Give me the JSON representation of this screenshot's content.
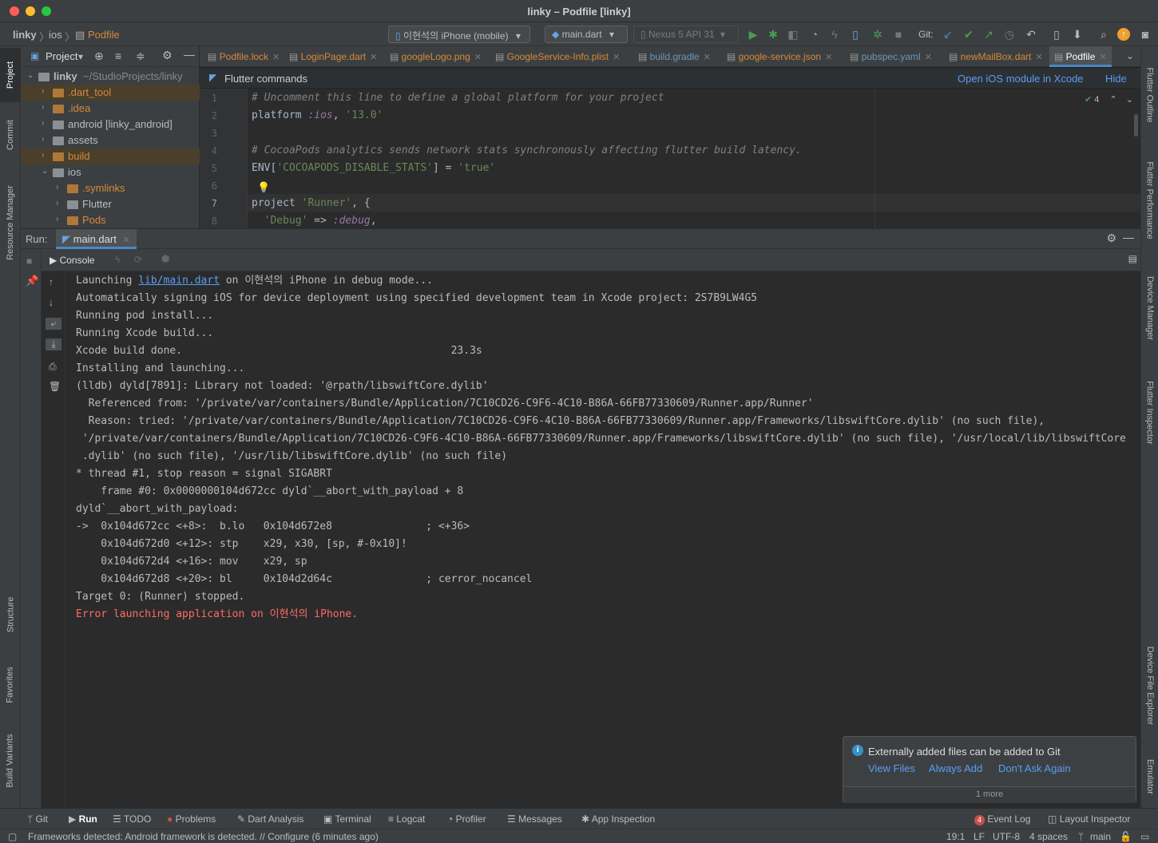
{
  "window": {
    "title": "linky – Podfile [linky]"
  },
  "nav": {
    "crumbs": [
      "linky",
      "ios",
      "Podfile"
    ],
    "device_combo": "이현석의 iPhone (mobile)",
    "run_config": "main.dart",
    "emulator_combo": "Nexus 5 API 31",
    "git_label": "Git:"
  },
  "project_panel": {
    "title": "Project",
    "items": [
      {
        "name": "linky",
        "suffix": "~/StudioProjects/linky",
        "level": 0,
        "expanded": true,
        "color": "#bbbbbb"
      },
      {
        "name": ".dart_tool",
        "level": 1,
        "expanded": false,
        "color": "#d48a3c"
      },
      {
        "name": ".idea",
        "level": 1,
        "expanded": false,
        "color": "#d48a3c"
      },
      {
        "name": "android [linky_android]",
        "level": 1,
        "expanded": false,
        "color": "#bbbbbb"
      },
      {
        "name": "assets",
        "level": 1,
        "expanded": false,
        "color": "#bbbbbb"
      },
      {
        "name": "build",
        "level": 1,
        "expanded": false,
        "color": "#d48a3c"
      },
      {
        "name": "ios",
        "level": 1,
        "expanded": true,
        "color": "#bbbbbb"
      },
      {
        "name": ".symlinks",
        "level": 2,
        "expanded": false,
        "color": "#d48a3c"
      },
      {
        "name": "Flutter",
        "level": 2,
        "expanded": false,
        "color": "#bbbbbb"
      },
      {
        "name": "Pods",
        "level": 2,
        "expanded": false,
        "color": "#d48a3c"
      }
    ]
  },
  "editor_tabs": [
    {
      "label": "Podfile.lock",
      "color": "#d48a3c"
    },
    {
      "label": "LoginPage.dart",
      "color": "#d48a3c"
    },
    {
      "label": "googleLogo.png",
      "color": "#d48a3c"
    },
    {
      "label": "GoogleService-Info.plist",
      "color": "#d48a3c"
    },
    {
      "label": "build.gradle",
      "color": "#6897bb"
    },
    {
      "label": "google-service.json",
      "color": "#d48a3c"
    },
    {
      "label": "pubspec.yaml",
      "color": "#6897bb"
    },
    {
      "label": "newMailBox.dart",
      "color": "#d48a3c"
    },
    {
      "label": "Podfile",
      "color": "#d48a3c",
      "active": true
    }
  ],
  "flutter_banner": {
    "title": "Flutter commands",
    "open_ios": "Open iOS module in Xcode",
    "hide": "Hide"
  },
  "editor": {
    "inspection_count": "4",
    "lines": [
      "1",
      "2",
      "3",
      "4",
      "5",
      "6",
      "7",
      "8"
    ]
  },
  "run_panel": {
    "label": "Run:",
    "tab": "main.dart",
    "console_tab": "Console",
    "output": [
      {
        "t": "on 이현석의 iPhone in debug mode...",
        "link": "lib/main.dart",
        "pre": "Launching "
      },
      {
        "t": "Automatically signing iOS for device deployment using specified development team in Xcode project: 2S7B9LW4G5"
      },
      {
        "t": "Running pod install..."
      },
      {
        "t": "Running Xcode build..."
      },
      {
        "t": "Xcode build done.                                           23.3s"
      },
      {
        "t": "Installing and launching..."
      },
      {
        "t": "(lldb) dyld[7891]: Library not loaded: '@rpath/libswiftCore.dylib'"
      },
      {
        "t": "  Referenced from: '/private/var/containers/Bundle/Application/7C10CD26-C9F6-4C10-B86A-66FB77330609/Runner.app/Runner'"
      },
      {
        "t": "  Reason: tried: '/private/var/containers/Bundle/Application/7C10CD26-C9F6-4C10-B86A-66FB77330609/Runner.app/Frameworks/libswiftCore.dylib' (no such file),"
      },
      {
        "t": " '/private/var/containers/Bundle/Application/7C10CD26-C9F6-4C10-B86A-66FB77330609/Runner.app/Frameworks/libswiftCore.dylib' (no such file), '/usr/local/lib/libswiftCore"
      },
      {
        "t": " .dylib' (no such file), '/usr/lib/libswiftCore.dylib' (no such file)"
      },
      {
        "t": "* thread #1, stop reason = signal SIGABRT"
      },
      {
        "t": "    frame #0: 0x0000000104d672cc dyld`__abort_with_payload + 8"
      },
      {
        "t": "dyld`__abort_with_payload:"
      },
      {
        "t": "->  0x104d672cc <+8>:  b.lo   0x104d672e8               ; <+36>"
      },
      {
        "t": "    0x104d672d0 <+12>: stp    x29, x30, [sp, #-0x10]!"
      },
      {
        "t": "    0x104d672d4 <+16>: mov    x29, sp"
      },
      {
        "t": "    0x104d672d8 <+20>: bl     0x104d2d64c               ; cerror_nocancel"
      },
      {
        "t": "Target 0: (Runner) stopped."
      },
      {
        "t": "Error launching application on 이현석의 iPhone.",
        "error": true
      }
    ]
  },
  "notification": {
    "message": "Externally added files can be added to Git",
    "actions": [
      "View Files",
      "Always Add",
      "Don't Ask Again"
    ],
    "more": "1 more"
  },
  "left_strip": [
    "Project",
    "Commit",
    "Resource Manager",
    "Structure",
    "Favorites",
    "Build Variants"
  ],
  "right_strip": [
    "Flutter Outline",
    "Flutter Performance",
    "Device Manager",
    "Flutter Inspector",
    "Device File Explorer",
    "Emulator"
  ],
  "bottom_tabs": [
    "Git",
    "Run",
    "TODO",
    "Problems",
    "Dart Analysis",
    "Terminal",
    "Logcat",
    "Profiler",
    "Messages",
    "App Inspection"
  ],
  "bottom_right": {
    "event_log": "Event Log",
    "event_count": "4",
    "layout_inspector": "Layout Inspector"
  },
  "status": {
    "message": "Frameworks detected: Android framework is detected. // Configure (6 minutes ago)",
    "position": "19:1",
    "line_sep": "LF",
    "encoding": "UTF-8",
    "indent": "4 spaces",
    "branch": "main"
  },
  "colors": {
    "accent": "#4a88c7",
    "error": "#ff6b68",
    "link": "#589df6",
    "run_green": "#499c54"
  }
}
